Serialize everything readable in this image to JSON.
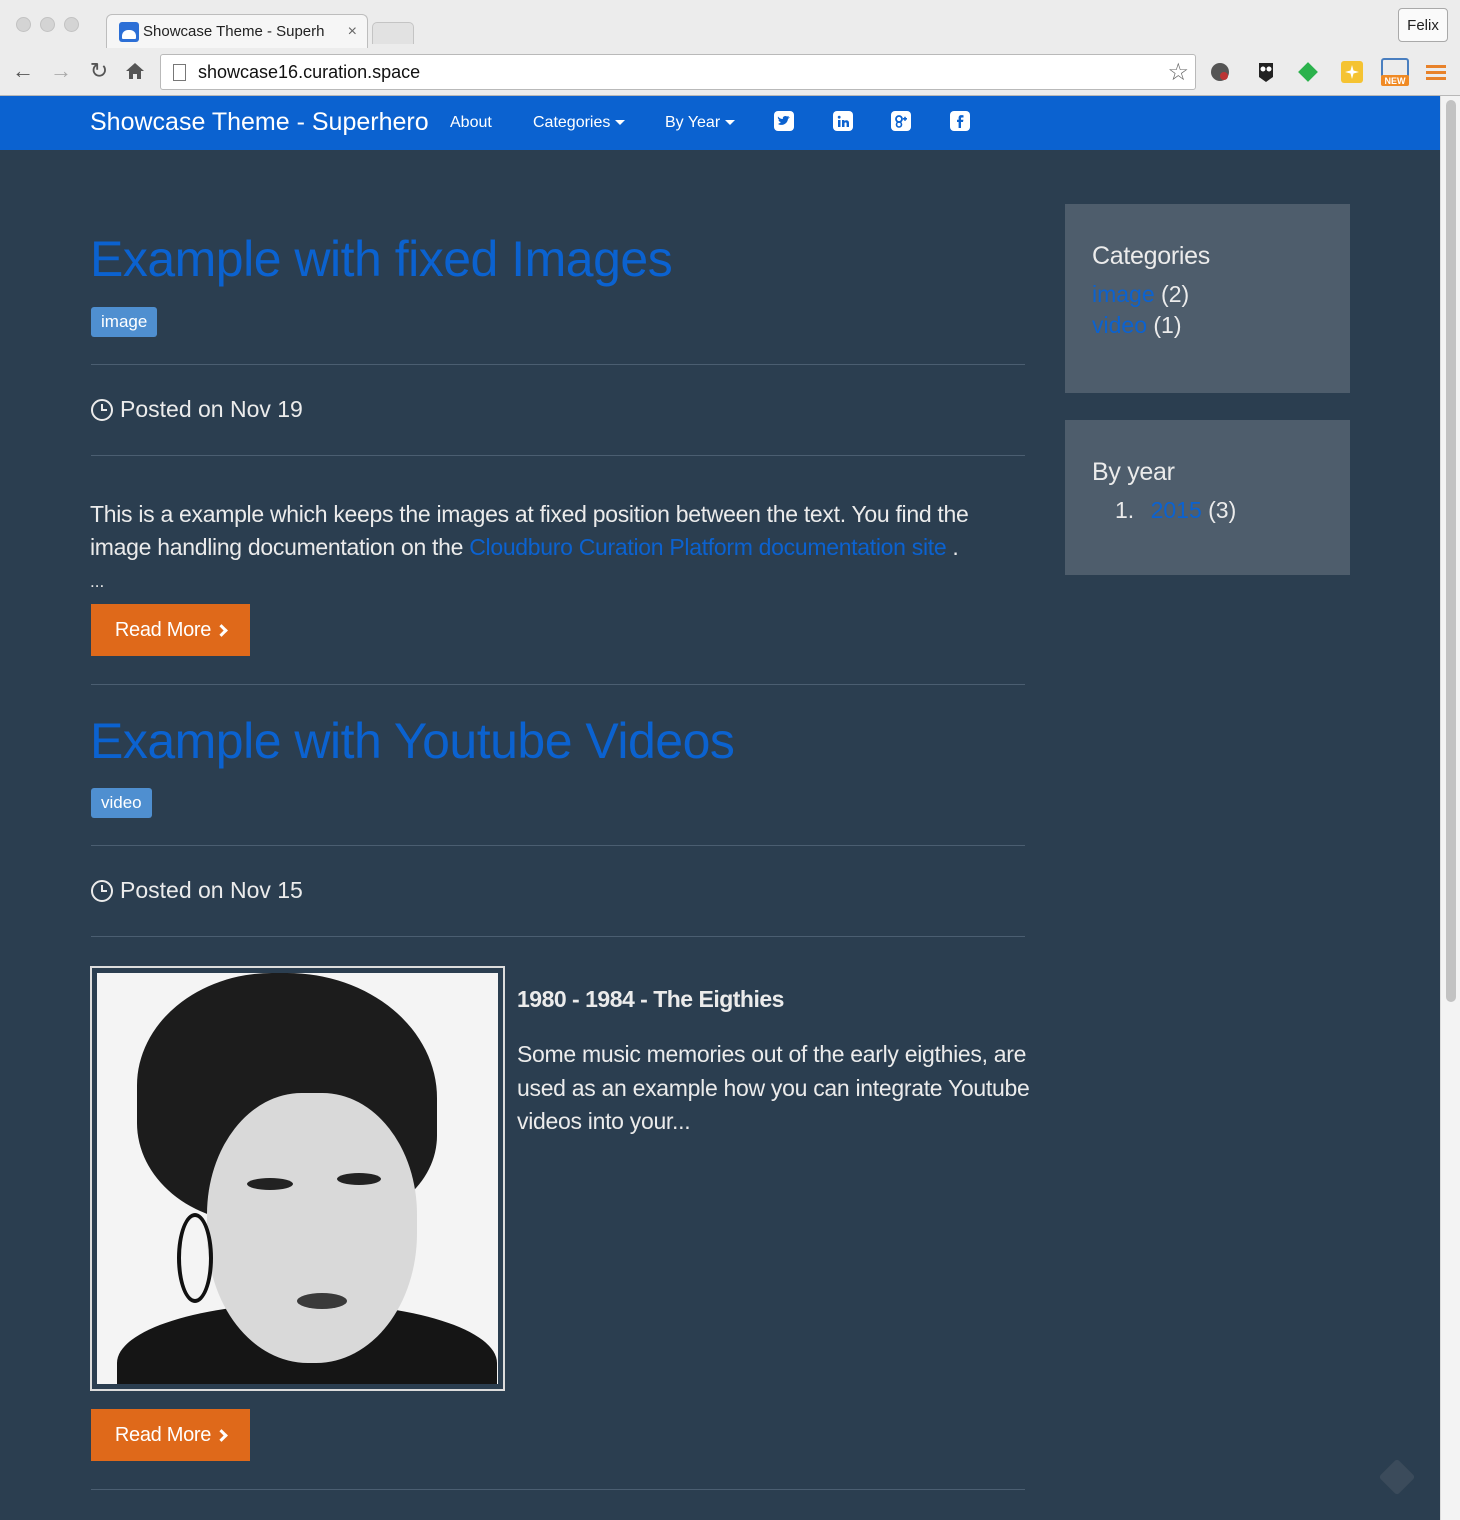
{
  "browser": {
    "tab_title": "Showcase Theme - Superh",
    "tab_close": "×",
    "profile_name": "Felix",
    "url": "showcase16.curation.space"
  },
  "navbar": {
    "brand": "Showcase Theme - Superhero",
    "links": [
      "About",
      "Categories",
      "By Year"
    ],
    "social_icons": [
      "twitter-icon",
      "linkedin-icon",
      "google-plus-icon",
      "facebook-icon"
    ]
  },
  "posts": [
    {
      "title": "Example with fixed Images",
      "tag": "image",
      "posted": "Posted on Nov 19",
      "excerpt_before": "This is a example which keeps the images at fixed position between the text. You find the image handling documentation on the ",
      "excerpt_link": "Cloudburo Curation Platform documentation site",
      "excerpt_after": " .",
      "ellipsis": "...",
      "read_more": "Read More"
    },
    {
      "title": "Example with Youtube Videos",
      "tag": "video",
      "posted": "Posted on Nov 15",
      "heading": "1980 - 1984 - The Eigthies",
      "text": "Some music memories out of the early eigthies, are used as an example how you can integrate Youtube videos into your...",
      "read_more": "Read More"
    }
  ],
  "sidebar": {
    "categories": {
      "title": "Categories",
      "items": [
        {
          "name": "image",
          "count": "(2)"
        },
        {
          "name": "video",
          "count": "(1)"
        }
      ]
    },
    "by_year": {
      "title": "By year",
      "items": [
        {
          "num": "1.",
          "year": "2015",
          "count": "(3)"
        }
      ]
    }
  },
  "colors": {
    "navbar": "#0b62d0",
    "background": "#2b3e50",
    "panel": "#4e5d6c",
    "button": "#df691a",
    "label": "#4f8fd0"
  }
}
